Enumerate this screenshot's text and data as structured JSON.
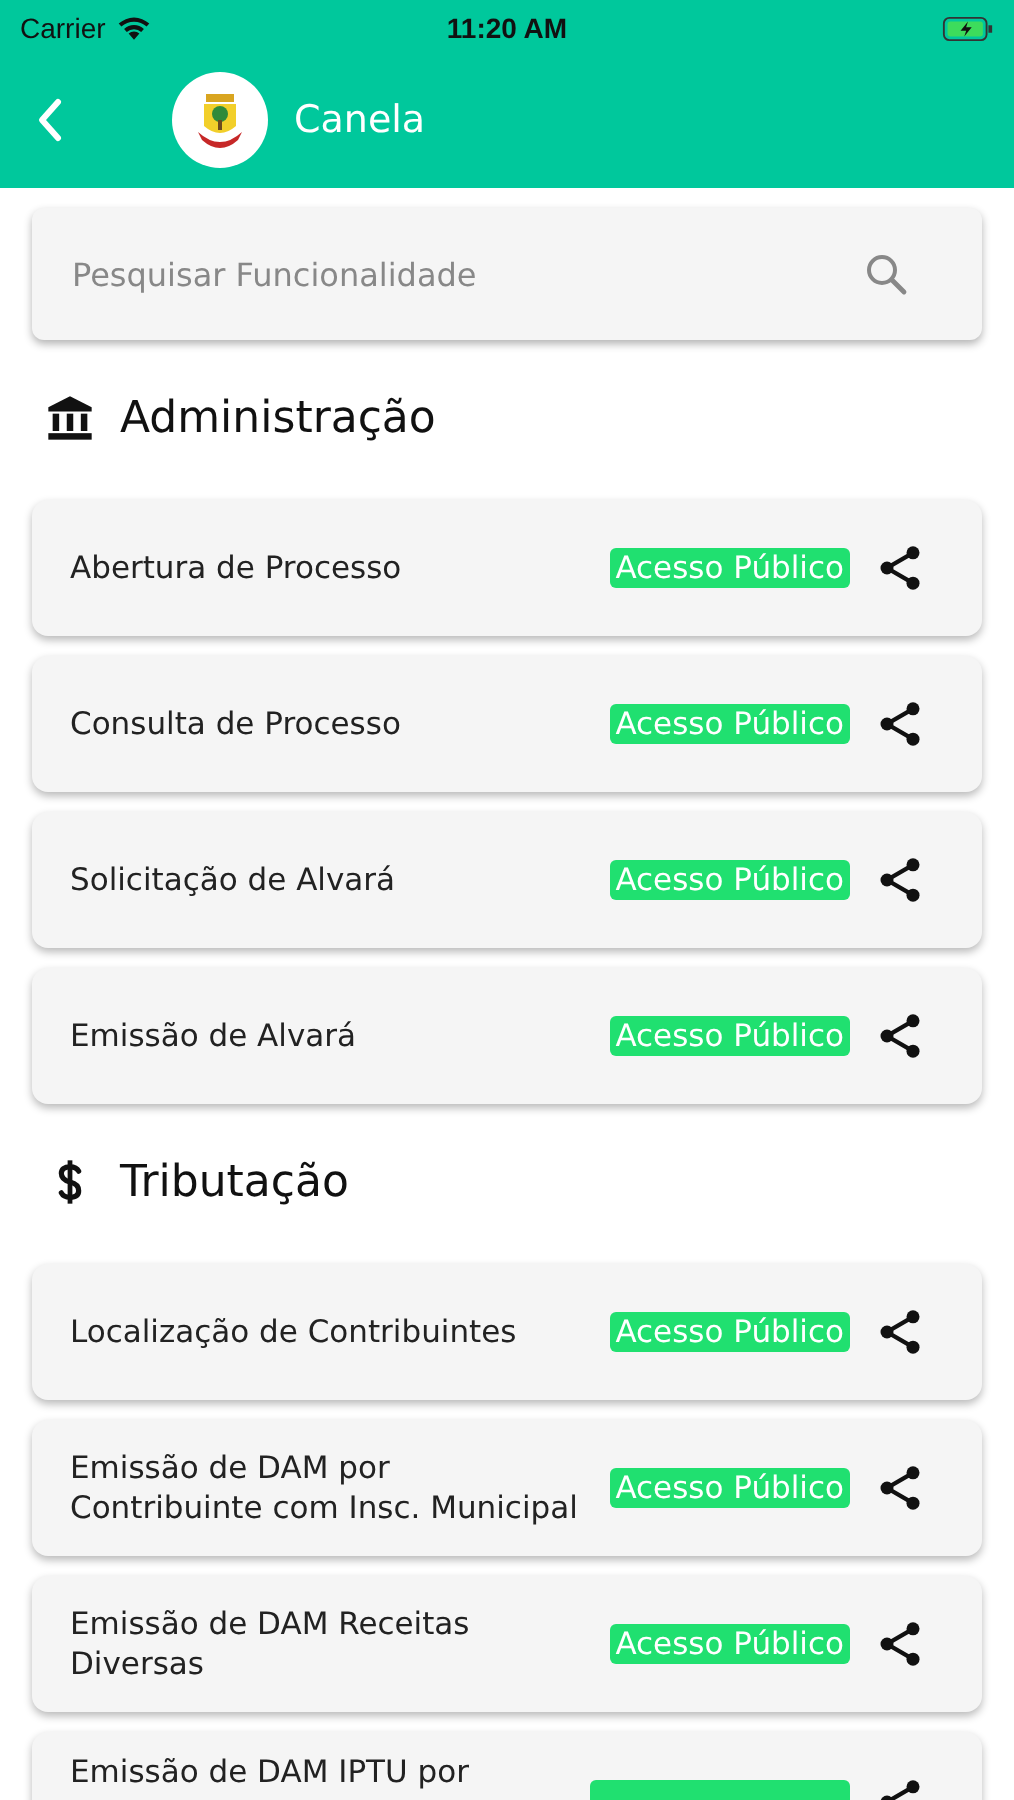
{
  "status_bar": {
    "carrier": "Carrier",
    "time": "11:20 AM"
  },
  "header": {
    "title": "Canela"
  },
  "search": {
    "placeholder": "Pesquisar Funcionalidade"
  },
  "sections": [
    {
      "kind": "building",
      "title": "Administração",
      "items": [
        {
          "title": "Abertura de Processo",
          "badge": "Acesso Público"
        },
        {
          "title": "Consulta de Processo",
          "badge": "Acesso Público"
        },
        {
          "title": "Solicitação de Alvará",
          "badge": "Acesso Público"
        },
        {
          "title": "Emissão de Alvará",
          "badge": "Acesso Público"
        }
      ]
    },
    {
      "kind": "dollar",
      "title": "Tributação",
      "items": [
        {
          "title": "Localização de Contribuintes",
          "badge": "Acesso Público"
        },
        {
          "title": "Emissão de DAM por Contribuinte com Insc. Municipal",
          "badge": "Acesso Público"
        },
        {
          "title": "Emissão de DAM Receitas Diversas",
          "badge": "Acesso Público"
        },
        {
          "title": "Emissão de DAM IPTU por"
        }
      ]
    }
  ]
}
